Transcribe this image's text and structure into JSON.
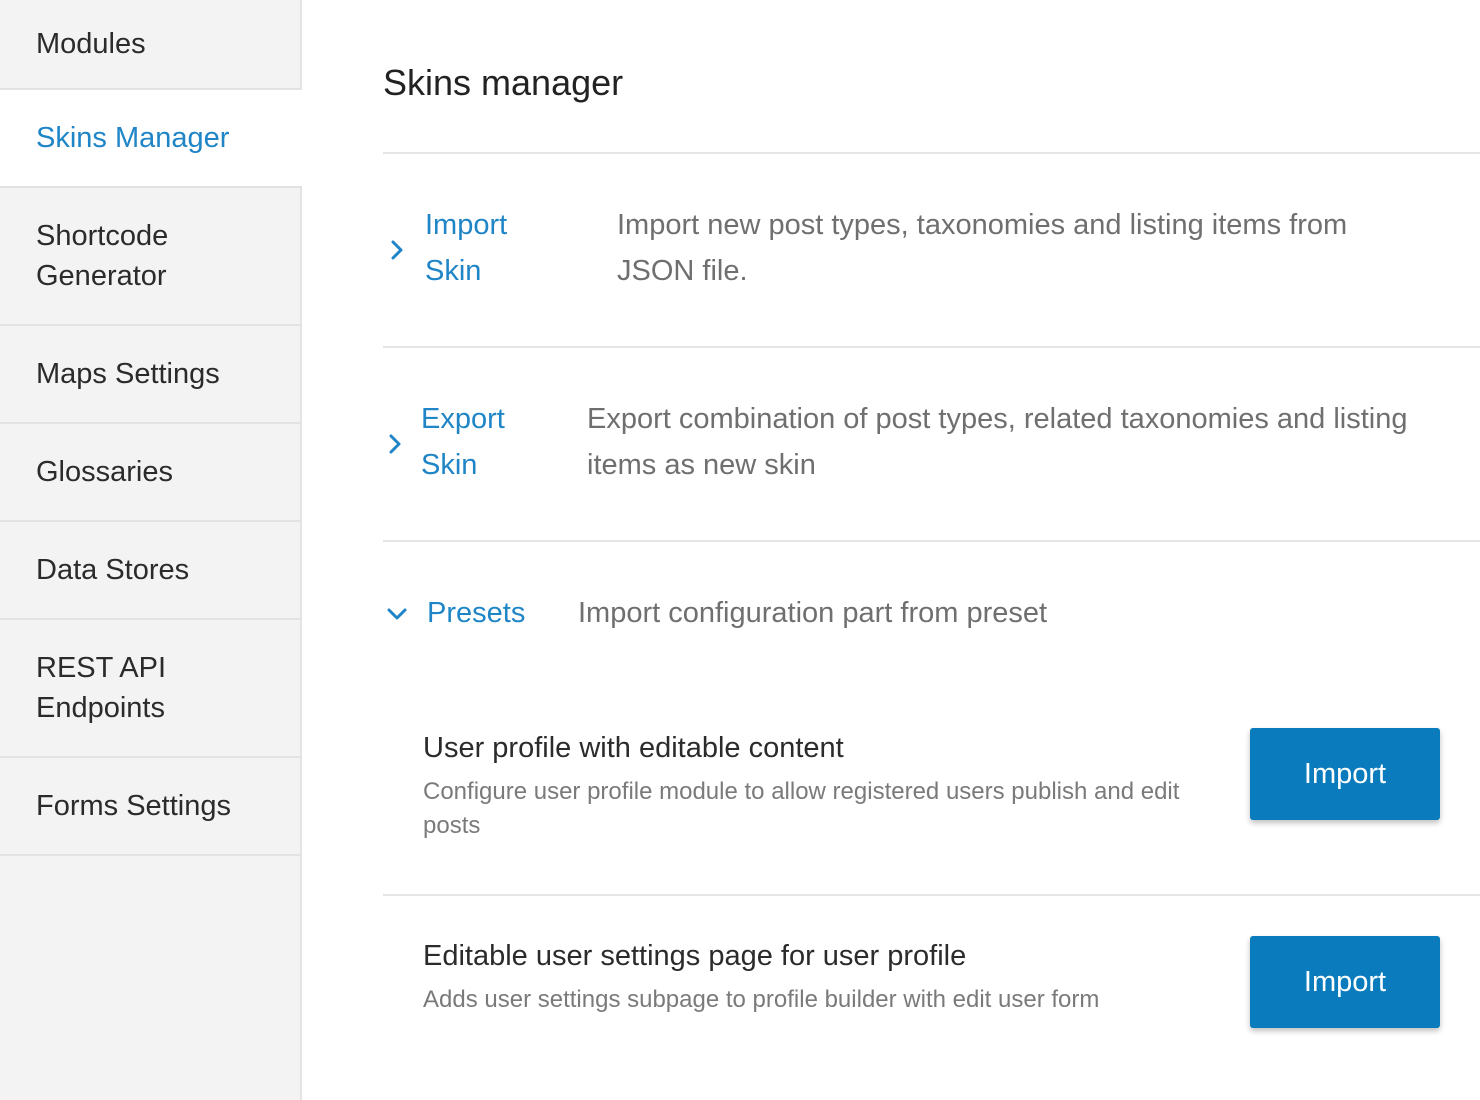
{
  "sidebar": {
    "items": [
      {
        "label": "Modules"
      },
      {
        "label": "Skins Manager",
        "active": true
      },
      {
        "label": "Shortcode\nGenerator"
      },
      {
        "label": "Maps Settings"
      },
      {
        "label": "Glossaries"
      },
      {
        "label": "Data Stores"
      },
      {
        "label": "REST API\nEndpoints"
      },
      {
        "label": "Forms Settings"
      }
    ]
  },
  "main": {
    "title": "Skins manager",
    "sections": [
      {
        "title_line1": "Import",
        "title_line2": "Skin",
        "desc_line1": "Import new post types, taxonomies and listing items from",
        "desc_line2": "JSON file.",
        "expanded": false
      },
      {
        "title_line1": "Export",
        "title_line2": "Skin",
        "desc_line1": "Export combination of post types, related taxonomies and listing",
        "desc_line2": "items as new skin",
        "expanded": false
      },
      {
        "title_line1": "Presets",
        "desc_line1": "Import configuration part from preset",
        "expanded": true
      }
    ],
    "presets": [
      {
        "title": "User profile with editable content",
        "desc": "Configure user profile module to allow registered users publish and edit posts",
        "button_label": "Import"
      },
      {
        "title": "Editable user settings page for user profile",
        "desc": "Adds user settings subpage to profile builder with edit user form",
        "button_label": "Import"
      }
    ]
  },
  "colors": {
    "accent": "#1f85c6",
    "button": "#0a7bbd",
    "sidebar_bg": "#f3f3f3"
  },
  "icons": {
    "collapsed": "chevron-right-icon",
    "expanded": "chevron-down-icon"
  }
}
